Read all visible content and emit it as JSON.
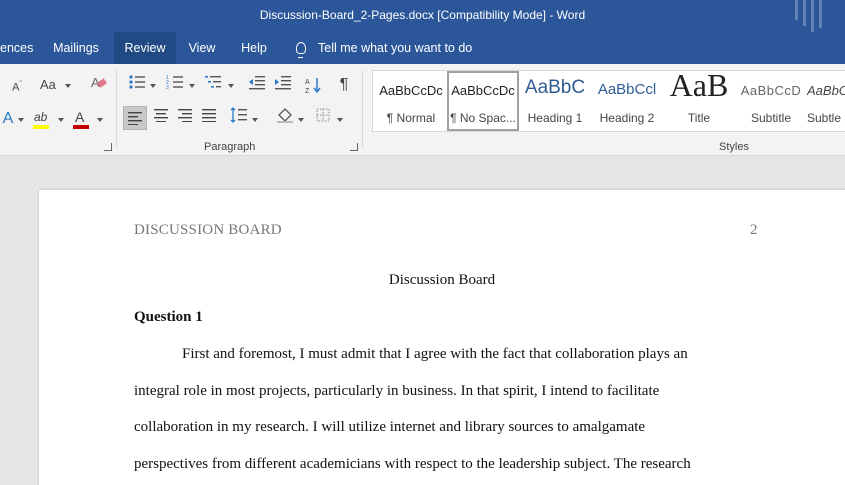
{
  "window": {
    "title": "Discussion-Board_2-Pages.docx [Compatibility Mode]  -  Word"
  },
  "tabs": [
    {
      "label": "ences"
    },
    {
      "label": "Mailings"
    },
    {
      "label": "Review"
    },
    {
      "label": "View"
    },
    {
      "label": "Help"
    }
  ],
  "active_tab": "Review",
  "tell_me": {
    "placeholder": "Tell me what you want to do"
  },
  "ribbon": {
    "font_group": {
      "change_case": "Aa",
      "font_color_letter": "A",
      "highlight_letters": "ab",
      "shrink_font": "A"
    },
    "paragraph": {
      "label": "Paragraph",
      "pilcrow": "¶",
      "sort": "A↓Z"
    },
    "styles": {
      "label": "Styles",
      "items": [
        {
          "preview": "AaBbCcDc",
          "name": "¶ Normal"
        },
        {
          "preview": "AaBbCcDc",
          "name": "¶ No Spac..."
        },
        {
          "preview": "AaBbC",
          "name": "Heading 1"
        },
        {
          "preview": "AaBbCcl",
          "name": "Heading 2"
        },
        {
          "preview": "AaB",
          "name": "Title"
        },
        {
          "preview": "AaBbCcD",
          "name": "Subtitle"
        },
        {
          "preview": "AaBbCcl",
          "name": "Subtle"
        }
      ],
      "selected_index": 1
    }
  },
  "colors": {
    "word_blue": "#2b579a",
    "font_color_red": "#c00000",
    "highlight_yellow": "#ffff00"
  },
  "document": {
    "running_head": "DISCUSSION BOARD",
    "page_number": "2",
    "title": "Discussion Board",
    "heading": "Question 1",
    "lines": [
      "First and foremost, I must admit that I agree with the fact that collaboration plays an",
      "integral role in most projects, particularly in business. In that spirit, I intend to facilitate",
      "collaboration in my research. I will utilize internet and library sources to amalgamate",
      "perspectives from different academicians with respect to the leadership subject. The research"
    ]
  }
}
